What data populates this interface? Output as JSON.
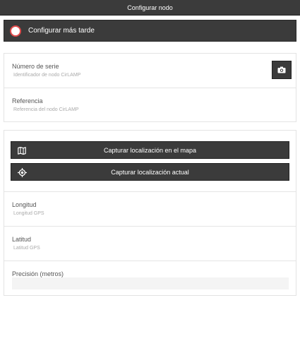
{
  "header": {
    "title": "Configurar nodo"
  },
  "configure_later": {
    "label": "Configurar más tarde"
  },
  "node_card": {
    "serial": {
      "label": "Número de serie",
      "placeholder": "Identificador de nodo CirLAMP"
    },
    "reference": {
      "label": "Referencia",
      "placeholder": "Referencia del nodo CirLAMP"
    }
  },
  "location_card": {
    "map_button": "Capturar localización en el mapa",
    "current_button": "Capturar localización actual",
    "longitude": {
      "label": "Longitud",
      "placeholder": "Longitud GPS"
    },
    "latitude": {
      "label": "Latitud",
      "placeholder": "Latitud GPS"
    },
    "precision": {
      "label": "Precisión (metros)"
    }
  },
  "colors": {
    "bar": "#3b3b3b",
    "radio_ring": "#e04a4a"
  },
  "icons": {
    "camera": "camera-icon",
    "map": "map-icon",
    "location": "crosshair-icon"
  }
}
